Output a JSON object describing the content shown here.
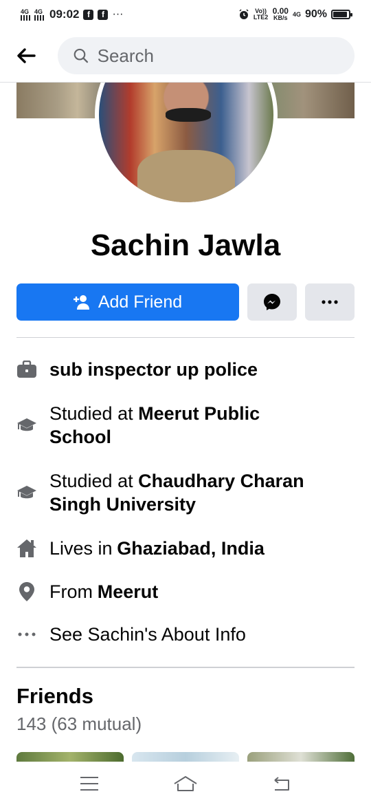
{
  "status_bar": {
    "net1": "4G",
    "net2": "4G",
    "time": "09:02",
    "fb_glyph": "f",
    "more": "···",
    "volte": "Vo)) LTE2",
    "speed_value": "0.00",
    "speed_unit": "KB/s",
    "net3": "4G",
    "battery": "90%",
    "battery_level": 0.9
  },
  "search": {
    "placeholder": "Search"
  },
  "profile": {
    "name": "Sachin Jawla",
    "add_friend_label": "Add Friend"
  },
  "info": {
    "work": "sub inspector up police",
    "edu1_prefix": "Studied at ",
    "edu1_name_line1": "Meerut Public",
    "edu1_name_line2": "School",
    "edu2_prefix": "Studied at ",
    "edu2_name_line1": "Chaudhary Charan",
    "edu2_name_line2": "Singh University",
    "lives_prefix": "Lives in ",
    "lives_place": "Ghaziabad, India",
    "from_prefix": "From ",
    "from_place": "Meerut",
    "about_link": "See Sachin's About Info"
  },
  "friends": {
    "title": "Friends",
    "count": "143 (63 mutual)"
  },
  "icons": {
    "back": "arrow-left-icon",
    "search": "search-icon",
    "add_friend": "person-plus-icon",
    "messenger": "messenger-icon",
    "more": "more-horizontal-icon",
    "work": "briefcase-icon",
    "education": "graduation-cap-icon",
    "home": "house-icon",
    "location": "location-pin-icon",
    "about": "ellipsis-icon"
  },
  "colors": {
    "primary": "#1877f2",
    "secondary_button": "#e4e6eb",
    "text_secondary": "#65676b",
    "icon_gray": "#65676b"
  }
}
